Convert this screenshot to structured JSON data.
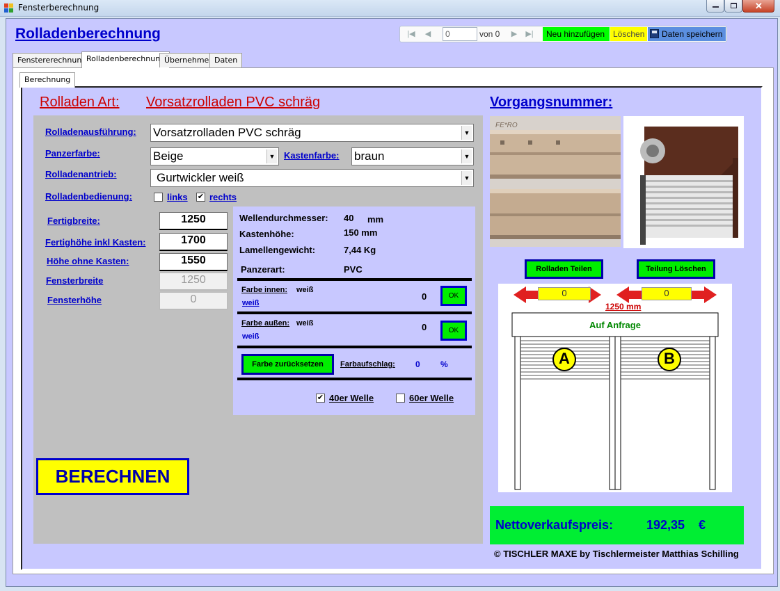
{
  "window": {
    "title": "Fensterberechnung"
  },
  "header": {
    "title": "Rolladenberechnung"
  },
  "navigator": {
    "position": "0",
    "of_label": "von 0",
    "new_label": "Neu hinzufügen",
    "delete_label": "Löschen",
    "save_label": "Daten speichern"
  },
  "tabs": [
    {
      "label": "Fenstererechnung"
    },
    {
      "label": "Rolladenberechnung"
    },
    {
      "label": "Übernehmen"
    },
    {
      "label": "Daten"
    }
  ],
  "subtab": {
    "label": "Berechnung"
  },
  "heading": {
    "art_label": "Rolladen Art:",
    "art_value": "Vorsatzrolladen PVC schräg",
    "vorgang_label": "Vorgangsnummer:"
  },
  "form": {
    "ausfuehrung_label": "Rolladenausführung:",
    "ausfuehrung_value": "Vorsatzrolladen PVC schräg",
    "panzerfarbe_label": "Panzerfarbe:",
    "panzerfarbe_value": "Beige",
    "kastenfarbe_label": "Kastenfarbe:",
    "kastenfarbe_value": "braun",
    "antrieb_label": "Rolladenantrieb:",
    "antrieb_value": "Gurtwickler weiß",
    "bedienung_label": "Rolladenbedienung:",
    "links_label": "links",
    "rechts_label": "rechts",
    "fertigbreite_label": "Fertigbreite:",
    "fertigbreite_value": "1250",
    "fertighoehe_label": "Fertighöhe inkl Kasten:",
    "fertighoehe_value": "1700",
    "hoehe_ohne_label": "Höhe ohne Kasten:",
    "hoehe_ohne_value": "1550",
    "fensterbreite_label": "Fensterbreite",
    "fensterbreite_value": "1250",
    "fensterhoehe_label": "Fensterhöhe",
    "fensterhoehe_value": "0"
  },
  "info": {
    "wellen_label": "Wellendurchmesser:",
    "wellen_value": "40",
    "wellen_unit": "mm",
    "kasten_label": "Kastenhöhe:",
    "kasten_value": "150 mm",
    "lamellen_label": "Lamellengewicht:",
    "lamellen_value": "7,44 Kg",
    "panzerart_label": "Panzerart:",
    "panzerart_value": "PVC",
    "farbe_innen_label": "Farbe innen:",
    "farbe_innen_value": "weiß",
    "farbe_innen_sub": "weiß",
    "farbe_innen_num": "0",
    "farbe_aussen_label": "Farbe außen:",
    "farbe_aussen_value": "weiß",
    "farbe_aussen_sub": "weiß",
    "farbe_aussen_num": "0",
    "ok_label": "OK",
    "reset_label": "Farbe zurücksetzen",
    "aufschlag_label": "Farbaufschlag:",
    "aufschlag_value": "0",
    "aufschlag_unit": "%",
    "welle40_label": "40er Welle",
    "welle60_label": "60er Welle"
  },
  "image_text": {
    "brand": "FE*RO"
  },
  "buttons": {
    "teilen_label": "Rolladen Teilen",
    "teilung_loeschen_label": "Teilung Löschen",
    "berechnen_label": "BERECHNEN"
  },
  "diagram": {
    "left_value": "0",
    "right_value": "0",
    "width_label": "1250 mm",
    "box_label": "Auf Anfrage",
    "a_label": "A",
    "b_label": "B"
  },
  "price": {
    "label": "Nettoverkaufspreis:",
    "value": "192,35",
    "currency": "€"
  },
  "footer": {
    "text": "© TISCHLER MAXE  by Tischlermeister Matthias Schilling"
  },
  "colors": {
    "panel": "#c8c8ff",
    "accent_green": "#00ee00",
    "accent_yellow": "#ffff00",
    "title_blue": "#0000cc",
    "heading_red": "#cc0000"
  }
}
